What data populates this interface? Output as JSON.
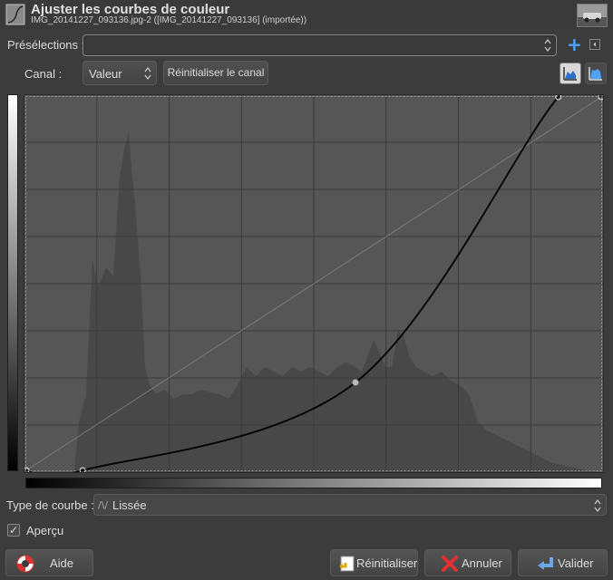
{
  "header": {
    "title": "Ajuster les courbes de couleur",
    "subtitle": "IMG_20141227_093136.jpg-2 ([IMG_20141227_093136] (importée))"
  },
  "presets": {
    "label": "Présélections :",
    "value": "",
    "add_icon": "plus-icon",
    "menu_icon": "menu-icon"
  },
  "channel": {
    "label": "Canal :",
    "value": "Valeur",
    "reset_label": "Réinitialiser le canal"
  },
  "curve_type": {
    "label": "Type de courbe :",
    "value": "Lissée"
  },
  "preview": {
    "label": "Aperçu",
    "checked": true
  },
  "buttons": {
    "help": "Aide",
    "reset": "Réinitialiser",
    "cancel": "Annuler",
    "ok": "Valider"
  },
  "curve": {
    "control_points": [
      [
        0,
        0
      ],
      [
        25,
        0
      ],
      [
        146,
        60
      ],
      [
        236,
        255
      ],
      [
        255,
        255
      ]
    ],
    "range": [
      0,
      255
    ]
  },
  "colors": {
    "background": "#3c3c3c",
    "curve_area": "#565656",
    "accent": "#4da3ff"
  }
}
